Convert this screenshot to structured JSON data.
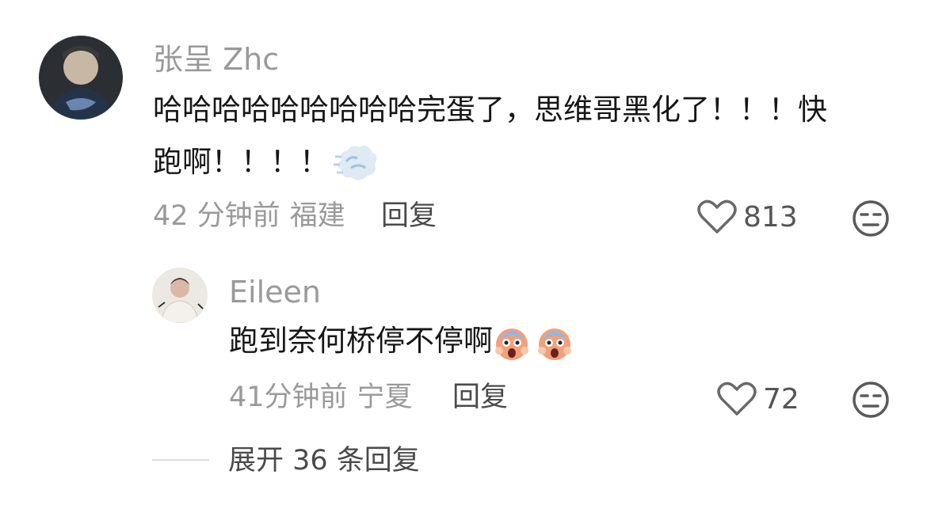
{
  "comment": {
    "username": "张呈 Zhc",
    "text_line1": "哈哈哈哈哈哈哈哈哈完蛋了，思维哥黑化了！！！快",
    "text_line2": "跑啊！！！！",
    "text_emoji": "dashing-away-emoji",
    "time": "42 分钟前",
    "location": "福建",
    "reply_label": "回复",
    "likes": "813",
    "avatar_icon": "user-avatar"
  },
  "reply": {
    "username": "Eileen",
    "text": "跑到奈何桥停不停啊",
    "text_emojis": [
      "screaming-face-emoji",
      "screaming-face-emoji"
    ],
    "time": "41分钟前",
    "location": "宁夏",
    "reply_label": "回复",
    "likes": "72",
    "avatar_icon": "user-avatar"
  },
  "expand": {
    "label": "展开 36 条回复"
  },
  "icons": {
    "like": "heart-outline-icon",
    "dislike": "unamused-face-icon"
  },
  "colors": {
    "username": "#9a9a9a",
    "text": "#161616",
    "meta": "#9a9a9a",
    "action": "#4a4a4a"
  }
}
